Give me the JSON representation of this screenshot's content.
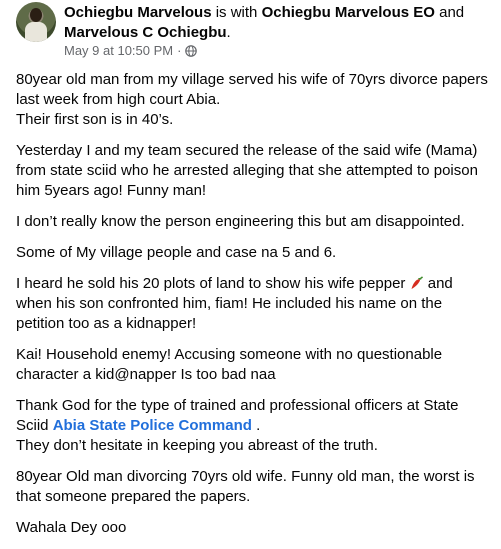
{
  "header": {
    "author": "Ochiegbu Marvelous",
    "with_text": " is with ",
    "tag1": "Ochiegbu Marvelous EO",
    "and_text": " and ",
    "tag2": "Marvelous C Ochiegbu",
    "period": ".",
    "timestamp": "May 9 at 10:50 PM",
    "separator": "·",
    "audience_icon": "globe-icon"
  },
  "post": {
    "p1": "80year old man from my village served his wife of 70yrs divorce papers last week from high court Abia.\n Their first son is in 40’s.",
    "p2": "Yesterday I and my team secured the release of the said wife (Mama) from state sciid who he arrested alleging that she attempted to poison him 5years ago! Funny man!",
    "p3": "I don’t really know the person engineering this but am disappointed.",
    "p4": "Some of My village people and case na 5 and 6.",
    "p5a": "I heard he sold his 20 plots of land to show his wife pepper ",
    "p5_icon": "chili-pepper-icon",
    "p5b": " and when his son confronted him, fiam! He included his name on the petition too as a kidnapper!",
    "p6": "Kai! Household enemy! Accusing someone with no questionable character  a kid@napper Is too bad naa",
    "p7a": "Thank God for the type of trained and professional officers at State Sciid ",
    "p7_link": "Abia State Police Command",
    "p7b": " .",
    "p7c": "They don’t hesitate in keeping you abreast of the truth.",
    "p8": "80year Old man divorcing 70yrs old wife. Funny old man, the worst is that someone prepared the  papers.",
    "p9": "Wahala Dey ooo"
  },
  "colors": {
    "link": "#216fdb",
    "meta": "#65676b",
    "text": "#050505"
  }
}
